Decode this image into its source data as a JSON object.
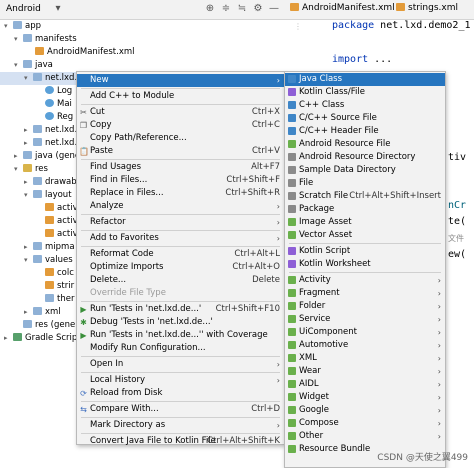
{
  "panel": {
    "title": "Android",
    "tree": [
      {
        "label": "app",
        "icon": "folder",
        "expanded": true
      },
      {
        "label": "manifests",
        "icon": "folder",
        "expanded": true
      },
      {
        "label": "AndroidManifest.xml",
        "icon": "xml"
      },
      {
        "label": "java",
        "icon": "folder",
        "expanded": true
      },
      {
        "label": "net.lxd.de",
        "icon": "folder",
        "expanded": true
      },
      {
        "label": "Log",
        "icon": "class"
      },
      {
        "label": "Mai",
        "icon": "class"
      },
      {
        "label": "Reg",
        "icon": "class"
      },
      {
        "label": "net.lxd.",
        "icon": "folder",
        "expanded": false
      },
      {
        "label": "net.lxd.",
        "icon": "folder",
        "expanded": false
      },
      {
        "label": "java (gene",
        "icon": "folder",
        "expanded": false
      },
      {
        "label": "res",
        "icon": "folder-y",
        "expanded": true
      },
      {
        "label": "drawab",
        "icon": "folder",
        "expanded": false
      },
      {
        "label": "layout",
        "icon": "folder",
        "expanded": true
      },
      {
        "label": "activ",
        "icon": "xml"
      },
      {
        "label": "activ",
        "icon": "xml"
      },
      {
        "label": "activ",
        "icon": "xml"
      },
      {
        "label": "mipma",
        "icon": "folder",
        "expanded": false
      },
      {
        "label": "values",
        "icon": "folder",
        "expanded": true
      },
      {
        "label": "colc",
        "icon": "xml"
      },
      {
        "label": "strir",
        "icon": "xml"
      },
      {
        "label": "ther",
        "icon": "folder"
      },
      {
        "label": "xml",
        "icon": "folder",
        "expanded": false
      },
      {
        "label": "res (gene",
        "icon": "folder"
      },
      {
        "label": "Gradle Script",
        "icon": "gradle",
        "expanded": false
      }
    ]
  },
  "editor": {
    "tabs": [
      "AndroidManifest.xml",
      "strings.xml"
    ],
    "lines": [
      {
        "kw": "package",
        "rest": " net.lxd.demo2_1"
      },
      {
        "kw": "import",
        "rest": " ..."
      }
    ],
    "fragments": [
      "tiv",
      "nCr",
      "te(",
      "文件",
      "ew("
    ]
  },
  "menu": {
    "items": [
      {
        "label": "New",
        "submenu": true,
        "selected": true
      },
      {
        "sep": true
      },
      {
        "label": "Add C++ to Module"
      },
      {
        "sep": true
      },
      {
        "label": "Cut",
        "shortcut": "Ctrl+X",
        "icon": "cut-icon"
      },
      {
        "label": "Copy",
        "shortcut": "Ctrl+C",
        "icon": "copy-icon"
      },
      {
        "label": "Copy Path/Reference..."
      },
      {
        "label": "Paste",
        "shortcut": "Ctrl+V",
        "icon": "paste-icon"
      },
      {
        "sep": true
      },
      {
        "label": "Find Usages",
        "shortcut": "Alt+F7"
      },
      {
        "label": "Find in Files...",
        "shortcut": "Ctrl+Shift+F"
      },
      {
        "label": "Replace in Files...",
        "shortcut": "Ctrl+Shift+R"
      },
      {
        "label": "Analyze",
        "submenu": true
      },
      {
        "sep": true
      },
      {
        "label": "Refactor",
        "submenu": true
      },
      {
        "sep": true
      },
      {
        "label": "Add to Favorites",
        "submenu": true
      },
      {
        "sep": true
      },
      {
        "label": "Reformat Code",
        "shortcut": "Ctrl+Alt+L"
      },
      {
        "label": "Optimize Imports",
        "shortcut": "Ctrl+Alt+O"
      },
      {
        "label": "Delete...",
        "shortcut": "Delete"
      },
      {
        "label": "Override File Type",
        "disabled": true
      },
      {
        "sep": true
      },
      {
        "label": "Run 'Tests in 'net.lxd.de...'",
        "shortcut": "Ctrl+Shift+F10",
        "icon": "run-icon"
      },
      {
        "label": "Debug 'Tests in 'net.lxd.de...'",
        "icon": "debug-icon"
      },
      {
        "label": "Run 'Tests in 'net.lxd.de...'' with Coverage",
        "icon": "coverage-icon"
      },
      {
        "label": "Modify Run Configuration..."
      },
      {
        "sep": true
      },
      {
        "label": "Open In",
        "submenu": true
      },
      {
        "sep": true
      },
      {
        "label": "Local History",
        "submenu": true
      },
      {
        "label": "Reload from Disk",
        "icon": "reload-icon"
      },
      {
        "sep": true
      },
      {
        "label": "Compare With...",
        "shortcut": "Ctrl+D",
        "icon": "compare-icon"
      },
      {
        "sep": true
      },
      {
        "label": "Mark Directory as",
        "submenu": true
      },
      {
        "sep": true
      },
      {
        "label": "Convert Java File to Kotlin File",
        "shortcut": "Ctrl+Alt+Shift+K"
      }
    ]
  },
  "submenu": {
    "items": [
      {
        "label": "Java Class",
        "icon": "blue",
        "selected": true
      },
      {
        "label": "Kotlin Class/File",
        "icon": "kot"
      },
      {
        "label": "C++ Class",
        "icon": "blue"
      },
      {
        "label": "C/C++ Source File",
        "icon": "blue"
      },
      {
        "label": "C/C++ Header File",
        "icon": "blue"
      },
      {
        "label": "Android Resource File",
        "icon": "andr"
      },
      {
        "label": "Android Resource Directory",
        "icon": "grey"
      },
      {
        "label": "Sample Data Directory",
        "icon": "grey"
      },
      {
        "label": "File",
        "icon": "grey"
      },
      {
        "label": "Scratch File",
        "icon": "grey",
        "shortcut": "Ctrl+Alt+Shift+Insert"
      },
      {
        "label": "Package",
        "icon": "grey"
      },
      {
        "label": "Image Asset",
        "icon": "andr"
      },
      {
        "label": "Vector Asset",
        "icon": "andr"
      },
      {
        "sep": true
      },
      {
        "label": "Kotlin Script",
        "icon": "kot"
      },
      {
        "label": "Kotlin Worksheet",
        "icon": "kot"
      },
      {
        "sep": true
      },
      {
        "label": "Activity",
        "icon": "andr",
        "submenu": true
      },
      {
        "label": "Fragment",
        "icon": "andr",
        "submenu": true
      },
      {
        "label": "Folder",
        "icon": "andr",
        "submenu": true
      },
      {
        "label": "Service",
        "icon": "andr",
        "submenu": true
      },
      {
        "label": "UiComponent",
        "icon": "andr",
        "submenu": true
      },
      {
        "label": "Automotive",
        "icon": "andr",
        "submenu": true
      },
      {
        "label": "XML",
        "icon": "andr",
        "submenu": true
      },
      {
        "label": "Wear",
        "icon": "andr",
        "submenu": true
      },
      {
        "label": "AIDL",
        "icon": "andr",
        "submenu": true
      },
      {
        "label": "Widget",
        "icon": "andr",
        "submenu": true
      },
      {
        "label": "Google",
        "icon": "andr",
        "submenu": true
      },
      {
        "label": "Compose",
        "icon": "andr",
        "submenu": true
      },
      {
        "label": "Other",
        "icon": "andr",
        "submenu": true
      },
      {
        "label": "Resource Bundle",
        "icon": "andr"
      }
    ]
  },
  "watermark": "CSDN @天使之翼499"
}
